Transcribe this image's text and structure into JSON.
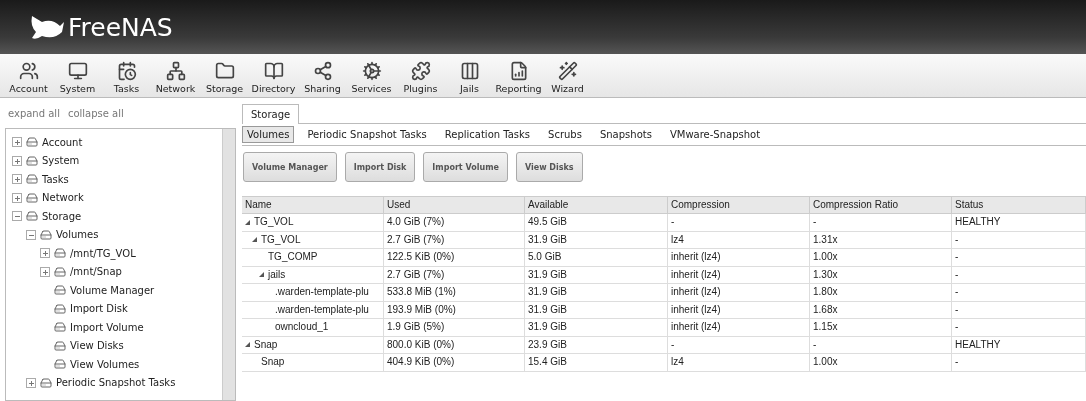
{
  "header": {
    "logo": "FreeNAS"
  },
  "toolbar": [
    "Account",
    "System",
    "Tasks",
    "Network",
    "Storage",
    "Directory",
    "Sharing",
    "Services",
    "Plugins",
    "Jails",
    "Reporting",
    "Wizard"
  ],
  "sidebar": {
    "links": [
      "expand all",
      "collapse all"
    ],
    "tree": [
      {
        "label": "Account",
        "expanded": false
      },
      {
        "label": "System",
        "expanded": false
      },
      {
        "label": "Tasks",
        "expanded": false
      },
      {
        "label": "Network",
        "expanded": false
      },
      {
        "label": "Storage",
        "expanded": true,
        "children": [
          {
            "label": "Volumes",
            "expanded": true,
            "children": [
              {
                "label": "/mnt/TG_VOL",
                "expanded": false
              },
              {
                "label": "/mnt/Snap",
                "expanded": false
              },
              {
                "label": "Volume Manager"
              },
              {
                "label": "Import Disk"
              },
              {
                "label": "Import Volume"
              },
              {
                "label": "View Disks"
              },
              {
                "label": "View Volumes"
              }
            ]
          },
          {
            "label": "Periodic Snapshot Tasks",
            "expanded": false
          }
        ]
      }
    ]
  },
  "tabs": [
    {
      "label": "Storage",
      "selected": true
    }
  ],
  "subtabs": [
    {
      "label": "Volumes",
      "selected": true
    },
    {
      "label": "Periodic Snapshot Tasks",
      "selected": false
    },
    {
      "label": "Replication Tasks",
      "selected": false
    },
    {
      "label": "Scrubs",
      "selected": false
    },
    {
      "label": "Snapshots",
      "selected": false
    },
    {
      "label": "VMware-Snapshot",
      "selected": false
    }
  ],
  "buttons": [
    "Volume Manager",
    "Import Disk",
    "Import Volume",
    "View Disks"
  ],
  "table": {
    "columns": [
      "Name",
      "Used",
      "Available",
      "Compression",
      "Compression Ratio",
      "Status"
    ],
    "rows": [
      {
        "cells": [
          "TG_VOL",
          "4.0 GiB (7%)",
          "49.5 GiB",
          "-",
          "-",
          "HEALTHY"
        ],
        "expanded": true,
        "children": [
          {
            "cells": [
              "TG_VOL",
              "2.7 GiB (7%)",
              "31.9 GiB",
              "lz4",
              "1.31x",
              "-"
            ],
            "expanded": true,
            "children": [
              {
                "cells": [
                  "TG_COMP",
                  "122.5 KiB (0%)",
                  "5.0 GiB",
                  "inherit (lz4)",
                  "1.00x",
                  "-"
                ]
              },
              {
                "cells": [
                  "jails",
                  "2.7 GiB (7%)",
                  "31.9 GiB",
                  "inherit (lz4)",
                  "1.30x",
                  "-"
                ],
                "expanded": true,
                "children": [
                  {
                    "cells": [
                      ".warden-template-plu",
                      "533.8 MiB (1%)",
                      "31.9 GiB",
                      "inherit (lz4)",
                      "1.80x",
                      "-"
                    ]
                  },
                  {
                    "cells": [
                      ".warden-template-plu",
                      "193.9 MiB (0%)",
                      "31.9 GiB",
                      "inherit (lz4)",
                      "1.68x",
                      "-"
                    ]
                  },
                  {
                    "cells": [
                      "owncloud_1",
                      "1.9 GiB (5%)",
                      "31.9 GiB",
                      "inherit (lz4)",
                      "1.15x",
                      "-"
                    ]
                  }
                ]
              }
            ]
          }
        ]
      },
      {
        "cells": [
          "Snap",
          "800.0 KiB (0%)",
          "23.9 GiB",
          "-",
          "-",
          "HEALTHY"
        ],
        "expanded": true,
        "children": [
          {
            "cells": [
              "Snap",
              "404.9 KiB (0%)",
              "15.4 GiB",
              "lz4",
              "1.00x",
              "-"
            ]
          }
        ]
      }
    ]
  }
}
